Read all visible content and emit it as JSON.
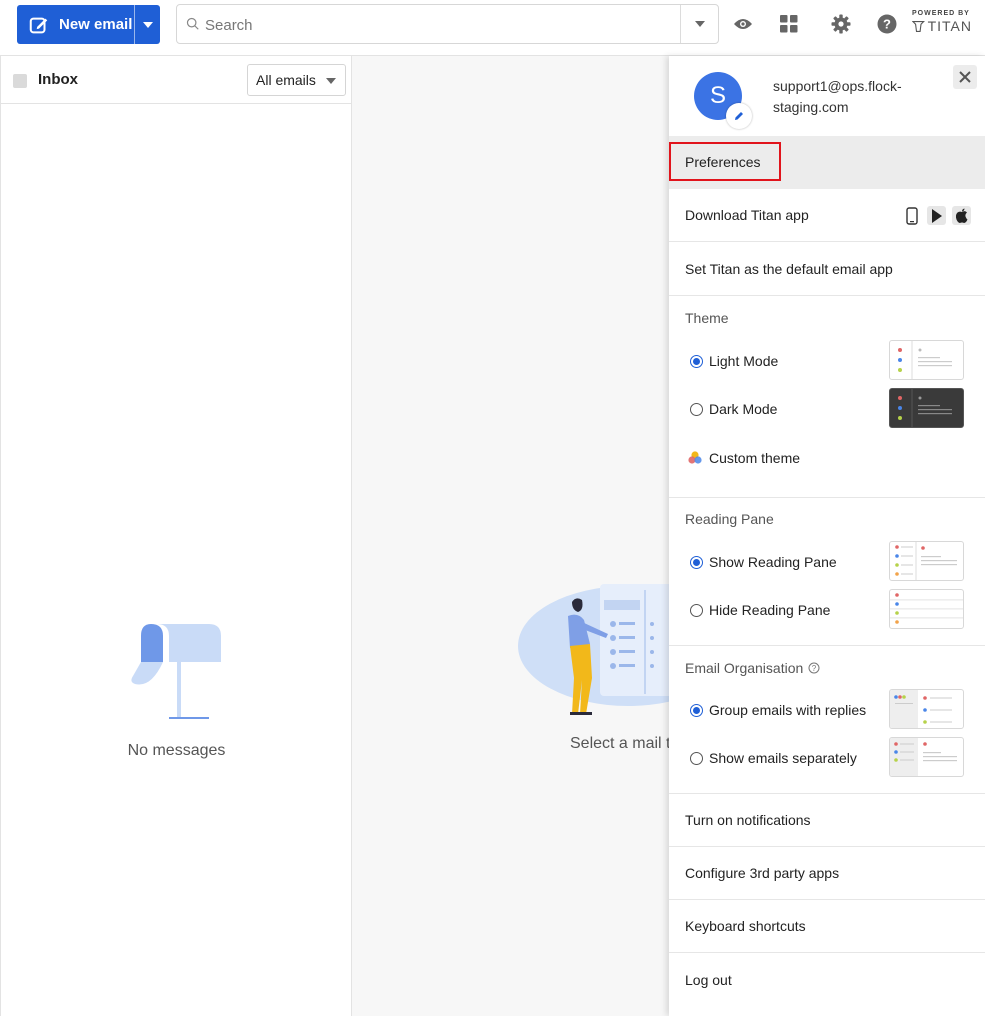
{
  "topbar": {
    "new_email_label": "New email",
    "search_placeholder": "Search",
    "powered_by": "POWERED BY",
    "brand": "TITAN",
    "icons": [
      "eye-icon",
      "apps-grid-icon",
      "gear-icon",
      "help-icon"
    ]
  },
  "mail_list": {
    "folder_title": "Inbox",
    "filter_value": "All emails",
    "empty_text": "No messages"
  },
  "reading_pane": {
    "placeholder_text": "Select a mail t"
  },
  "settings": {
    "avatar_letter": "S",
    "account_email": "support1@ops.flock-staging.com",
    "rows": {
      "preferences": "Preferences",
      "download_app": "Download Titan app",
      "set_default": "Set Titan as the default email app",
      "notifications": "Turn on notifications",
      "third_party": "Configure 3rd party apps",
      "shortcuts": "Keyboard shortcuts",
      "logout": "Log out"
    },
    "theme": {
      "title": "Theme",
      "light": "Light Mode",
      "dark": "Dark Mode",
      "custom": "Custom theme",
      "selected": "Light Mode"
    },
    "reading_pane": {
      "title": "Reading Pane",
      "show": "Show Reading Pane",
      "hide": "Hide Reading Pane",
      "selected": "Show Reading Pane"
    },
    "organisation": {
      "title": "Email Organisation",
      "group": "Group emails with replies",
      "separate": "Show emails separately",
      "selected": "Group emails with replies"
    }
  },
  "colors": {
    "accent": "#1f5fd6",
    "highlight_border": "#e1141c",
    "avatar": "#3b73e4"
  }
}
